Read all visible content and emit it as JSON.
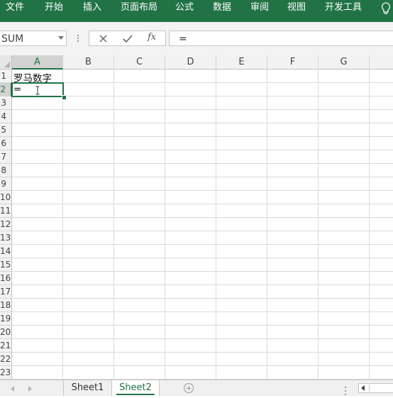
{
  "ribbon": {
    "tabs": [
      {
        "label": "文件"
      },
      {
        "label": "开始"
      },
      {
        "label": "插入"
      },
      {
        "label": "页面布局"
      },
      {
        "label": "公式"
      },
      {
        "label": "数据"
      },
      {
        "label": "审阅"
      },
      {
        "label": "视图"
      },
      {
        "label": "开发工具"
      }
    ],
    "help_icon": "lightbulb-icon",
    "color": "#217346"
  },
  "formula_bar": {
    "name_box": "SUM",
    "cancel_icon": "close-icon",
    "enter_icon": "check-icon",
    "fx_label": "fx",
    "content": "="
  },
  "grid": {
    "columns": [
      "A",
      "B",
      "C",
      "D",
      "E",
      "F",
      "G"
    ],
    "rows": [
      "1",
      "2",
      "3",
      "4",
      "5",
      "6",
      "7",
      "8",
      "9",
      "10",
      "11",
      "12",
      "13",
      "14",
      "15",
      "16",
      "17",
      "18",
      "19",
      "20",
      "21",
      "22",
      "23"
    ],
    "selected_column": "A",
    "selected_row": "2",
    "cells": {
      "A1": "罗马数字",
      "A2": "="
    }
  },
  "sheets": {
    "tabs": [
      "Sheet1",
      "Sheet2"
    ],
    "active": "Sheet2"
  },
  "accent_color": "#217346"
}
